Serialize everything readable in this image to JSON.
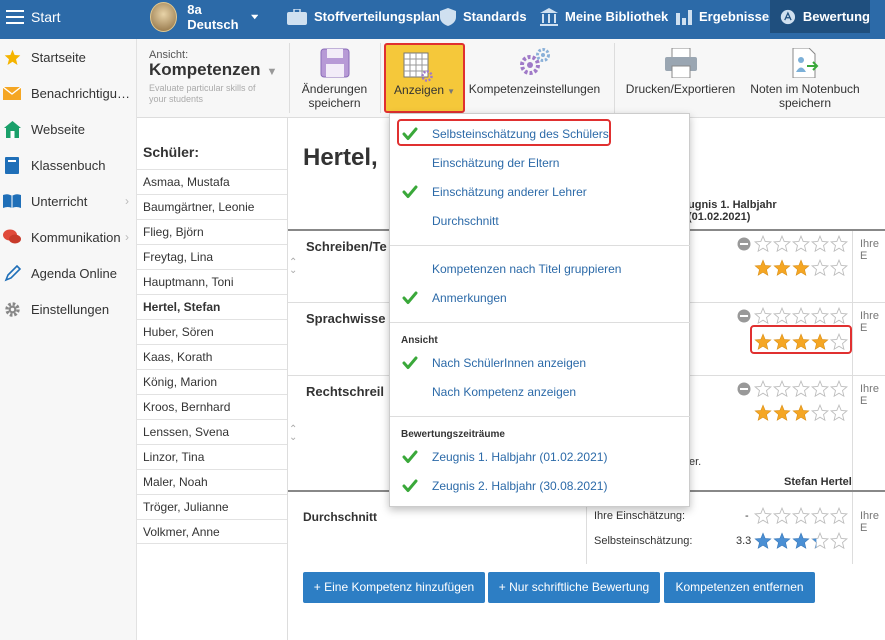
{
  "topbar": {
    "menu_label": "Start",
    "class_name": "8a",
    "class_subject": "Deutsch",
    "nav": [
      "Stoffverteilungsplan",
      "Standards",
      "Meine Bibliothek",
      "Ergebnisse",
      "Bewertung"
    ],
    "active_nav": "Bewertung"
  },
  "sidebar": {
    "items": [
      {
        "label": "Startseite",
        "icon": "star-icon"
      },
      {
        "label": "Benachrichtigu…",
        "icon": "envelope-icon"
      },
      {
        "label": "Webseite",
        "icon": "home-icon"
      },
      {
        "label": "Klassenbuch",
        "icon": "book-icon"
      },
      {
        "label": "Unterricht",
        "icon": "open-book-icon"
      },
      {
        "label": "Kommunikation",
        "icon": "chat-icon"
      },
      {
        "label": "Agenda Online",
        "icon": "pen-icon"
      },
      {
        "label": "Einstellungen",
        "icon": "gear-icon"
      }
    ]
  },
  "toolbar": {
    "ansicht_label": "Ansicht:",
    "ansicht_value": "Kompetenzen",
    "ansicht_sub": "Evaluate particular skills of your students",
    "save_label": "Änderungen speichern",
    "anzeigen_label": "Anzeigen",
    "settings_label": "Kompetenzeinstellungen",
    "print_label": "Drucken/Exportieren",
    "notes_label": "Noten im Notenbuch speichern"
  },
  "students": {
    "header": "Schüler:",
    "list": [
      "Asmaa, Mustafa",
      "Baumgärtner, Leonie",
      "Flieg, Björn",
      "Freytag, Lina",
      "Hauptmann, Toni",
      "Hertel, Stefan",
      "Huber, Sören",
      "Kaas, Korath",
      "König, Marion",
      "Kroos, Bernhard",
      "Lenssen, Svena",
      "Linzor, Tina",
      "Maler, Noah",
      "Tröger, Julianne",
      "Volkmer, Anne"
    ],
    "selected": "Hertel, Stefan"
  },
  "main": {
    "name_heading": "Hertel,",
    "zeugnis_head_1": "ugnis 1. Halbjahr",
    "zeugnis_head_2": "(01.02.2021)",
    "competencies": [
      {
        "title": "Schreiben/Te",
        "rating": 3
      },
      {
        "title": "Sprachwisse",
        "rating": 4
      },
      {
        "title": "Rechtschreil",
        "rating": 3
      }
    ],
    "ihre_label": "Ihre E",
    "note_text": "sser.",
    "note_author": "Stefan Hertel",
    "average_title": "Durchschnitt",
    "avg_own_label": "Ihre Einschätzung:",
    "avg_own_value": "-",
    "avg_self_label": "Selbsteinschätzung:",
    "avg_self_value": "3.3",
    "avg_self_rating": 3.3
  },
  "buttons": {
    "add_competence": "+ Eine Kompetenz hinzufügen",
    "add_written": "+ Nur schriftliche Bewertung",
    "remove": "Kompetenzen entfernen"
  },
  "dropdown": {
    "items_1": [
      {
        "label": "Selbsteinschätzung des Schülers",
        "checked": true
      },
      {
        "label": "Einschätzung der Eltern",
        "checked": false
      },
      {
        "label": "Einschätzung anderer Lehrer",
        "checked": true
      },
      {
        "label": "Durchschnitt",
        "checked": false
      }
    ],
    "items_2": [
      {
        "label": "Kompetenzen nach Titel gruppieren",
        "checked": false
      },
      {
        "label": "Anmerkungen",
        "checked": true
      }
    ],
    "section_ansicht": "Ansicht",
    "items_3": [
      {
        "label": "Nach SchülerInnen anzeigen",
        "checked": true
      },
      {
        "label": "Nach Kompetenz anzeigen",
        "checked": false
      }
    ],
    "section_zeitraeume": "Bewertungszeiträume",
    "items_4": [
      {
        "label": "Zeugnis 1. Halbjahr (01.02.2021)",
        "checked": true
      },
      {
        "label": "Zeugnis 2. Halbjahr (30.08.2021)",
        "checked": true
      }
    ]
  },
  "colors": {
    "topbar": "#2c6aa8",
    "active_nav": "#1f4f7e",
    "accent_button": "#2d7ec4",
    "star_gold": "#f5a623",
    "star_blue": "#4a8fd4",
    "check_green": "#3aa83a",
    "highlight_red": "#e03030",
    "anzeigen_yellow": "#f5c83a"
  }
}
